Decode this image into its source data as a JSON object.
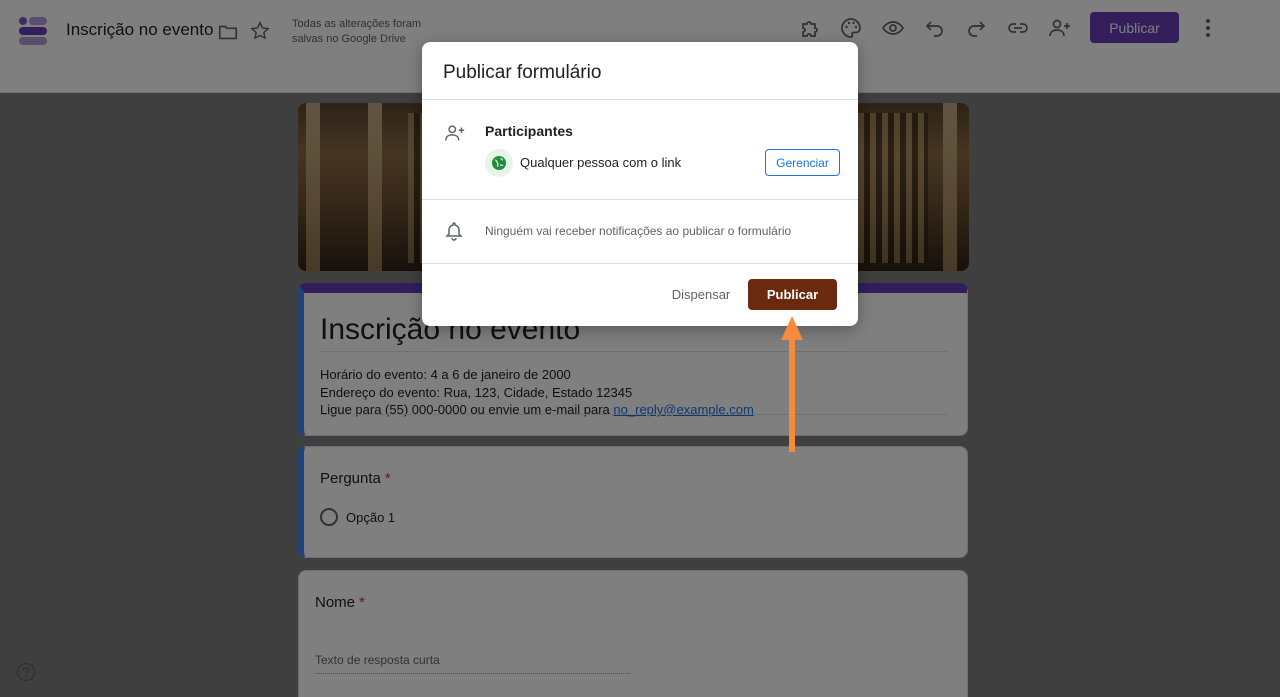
{
  "header": {
    "doc_title": "Inscrição no evento",
    "save_status_line1": "Todas as alterações foram",
    "save_status_line2": "salvas no Google Drive",
    "publish_label": "Publicar"
  },
  "form": {
    "title": "Inscrição no evento",
    "desc_line1": "Horário do evento: 4 a 6 de janeiro de 2000",
    "desc_line2": "Endereço do evento: Rua, 123, Cidade, Estado 12345",
    "desc_line3_prefix": "Ligue para (55) 000-0000 ou envie um e-mail para",
    "email": "no_reply@example.com",
    "question1": {
      "title": "Pergunta",
      "required_mark": "*",
      "option": "Opção 1"
    },
    "question2": {
      "title": "Nome",
      "required_mark": "*",
      "placeholder": "Texto de resposta curta"
    }
  },
  "dialog": {
    "title": "Publicar formulário",
    "participants_label": "Participantes",
    "audience": "Qualquer pessoa com o link",
    "manage_label": "Gerenciar",
    "notify_text": "Ninguém vai receber notificações ao publicar o formulário",
    "dismiss_label": "Dispensar",
    "publish_label": "Publicar"
  },
  "colors": {
    "accent": "#673ab7",
    "publish_dialog": "#6b2a10",
    "arrow": "#f58a3a",
    "link": "#1a73e8"
  }
}
